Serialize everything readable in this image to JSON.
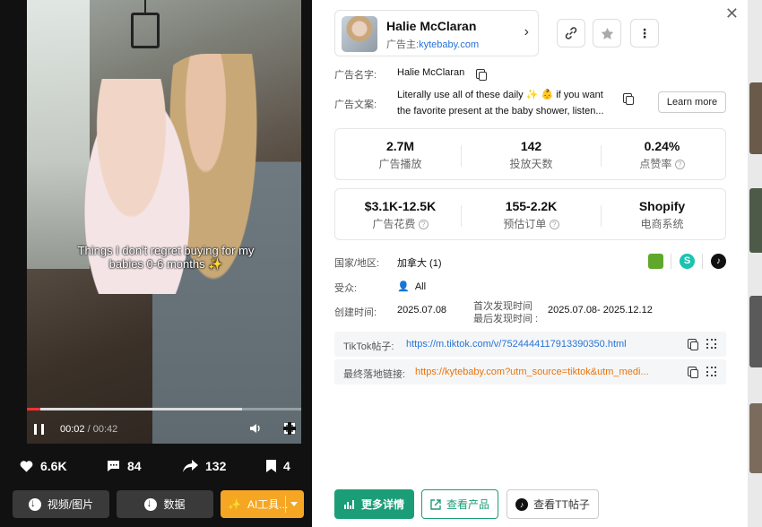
{
  "video": {
    "caption": "Things I don't regret buying for my babies 0-6 months ✨",
    "time_current": "00:02",
    "time_sep": " / ",
    "time_total": "00:42",
    "progress": 0.05
  },
  "engagement": {
    "likes": "6.6K",
    "comments": "84",
    "shares": "132",
    "saves": "4"
  },
  "left_buttons": {
    "media": "视频/图片",
    "data": "数据",
    "ai": "AI工具..."
  },
  "profile": {
    "name": "Halie McClaran",
    "advertiser_label": "广告主:",
    "advertiser_domain": "kytebaby.com"
  },
  "ad": {
    "name_label": "广告名字:",
    "name_value": "Halie McClaran",
    "copy_label": "广告文案:",
    "copy_line1": "Literally use all of these daily ✨ 👶 if you want",
    "copy_line2": "the favorite present at the baby shower, listen...",
    "learn_more": "Learn more"
  },
  "metrics1": [
    {
      "value": "2.7M",
      "label": "广告播放"
    },
    {
      "value": "142",
      "label": "投放天数"
    },
    {
      "value": "0.24%",
      "label": "点赞率"
    }
  ],
  "metrics2": [
    {
      "value": "$3.1K-12.5K",
      "label": "广告花费"
    },
    {
      "value": "155-2.2K",
      "label": "预估订单"
    },
    {
      "value": "Shopify",
      "label": "电商系统"
    }
  ],
  "info": {
    "region_label": "国家/地区:",
    "region_value": "加拿大 (1)",
    "audience_label": "受众:",
    "audience_value": "All",
    "created_label": "创建时间:",
    "created_value": "2025.07.08",
    "first_seen_label": "首次发现时间",
    "last_seen_label": "最后发现时间 :",
    "seen_range": "2025.07.08- 2025.12.12"
  },
  "links": {
    "tiktok_label": "TikTok帖子:",
    "tiktok_url": "https://m.tiktok.com/v/7524444117913390350.html",
    "landing_label": "最终落地链接:",
    "landing_url": "https://kytebaby.com?utm_source=tiktok&utm_medi..."
  },
  "actions": {
    "more_details": "更多详情",
    "view_product": "查看产品",
    "view_tt": "查看TT帖子"
  },
  "colors": {
    "accent_green": "#1b9e77",
    "link_blue": "#2a74d6",
    "link_orange": "#e8730c",
    "ai_orange": "#f5a623"
  }
}
